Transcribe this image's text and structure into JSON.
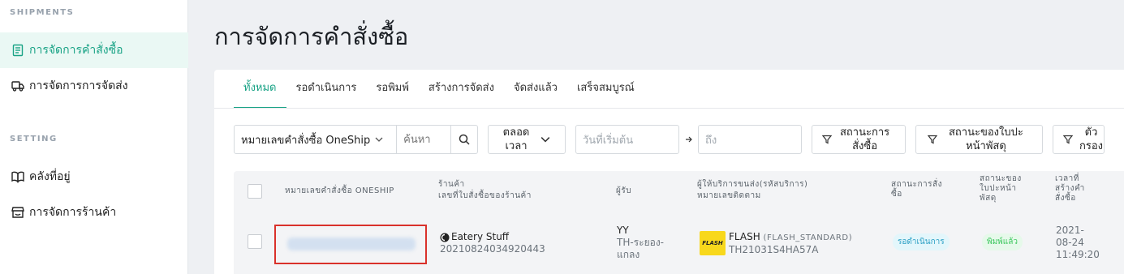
{
  "sidebar": {
    "section_shipments": "SHIPMENTS",
    "section_setting": "SETTING",
    "items": [
      {
        "label": "การจัดการคำสั่งซื้อ",
        "icon": "document-icon",
        "active": true
      },
      {
        "label": "การจัดการการจัดส่ง",
        "icon": "truck-icon",
        "active": false
      },
      {
        "label": "คลังที่อยู่",
        "icon": "book-icon",
        "active": false
      },
      {
        "label": "การจัดการร้านค้า",
        "icon": "store-icon",
        "active": false
      }
    ]
  },
  "page_title": "การจัดการคำสั่งซื้อ",
  "tabs": [
    {
      "label": "ทั้งหมด",
      "active": true
    },
    {
      "label": "รอดำเนินการ"
    },
    {
      "label": "รอพิมพ์"
    },
    {
      "label": "สร้างการจัดส่ง"
    },
    {
      "label": "จัดส่งแล้ว"
    },
    {
      "label": "เสร็จสมบูรณ์"
    }
  ],
  "filters": {
    "search_type": "หมายเลขคำสั่งซื้อ OneShip",
    "search_placeholder": "ค้นหา",
    "period_line1": "ตลอด",
    "period_line2": "เวลา",
    "start_date_placeholder": "วันที่เริ่มต้น",
    "end_date_placeholder": "ถึง",
    "order_status_line1": "สถานะการ",
    "order_status_line2": "สั่งซื้อ",
    "label_status_line1": "สถานะของใบปะ",
    "label_status_line2": "หน้าพัสดุ",
    "filter_line1": "ตัว",
    "filter_line2": "กรอง"
  },
  "table": {
    "headers": {
      "oneship_no": "หมายเลขคำสั่งซื้อ ONESHIP",
      "store": "ร้านค้า",
      "store_sub": "เลขที่ใบสั่งซื้อของร้านค้า",
      "recipient": "ผู้รับ",
      "carrier": "ผู้ให้บริการขนส่ง",
      "carrier_code": "(รหัสบริการ)",
      "tracking": "หมายเลขติดตาม",
      "order_status_1": "สถานะการสั่ง",
      "order_status_2": "ซื้อ",
      "label_status_1": "สถานะของ",
      "label_status_2": "ใบปะหน้า",
      "label_status_3": "พัสดุ",
      "created_1": "เวลาที่",
      "created_2": "สร้างคำ",
      "created_3": "สั่งซื้อ"
    },
    "rows": [
      {
        "store_name": "Eatery Stuff",
        "store_order": "20210824034920443",
        "recipient_name": "YY",
        "recipient_addr_1": "TH-ระยอง-",
        "recipient_addr_2": "แกลง",
        "carrier_name": "FLASH",
        "carrier_service": "(FLASH_STANDARD)",
        "tracking_no": "TH21031S4HA57A",
        "carrier_logo_text": "FLASH",
        "order_status": "รอดำเนินการ",
        "label_status": "พิมพ์แล้ว",
        "created_date_1": "2021-",
        "created_date_2": "08-24",
        "created_time": "11:49:20"
      }
    ]
  },
  "colors": {
    "accent": "#1aa386",
    "highlight_border": "#d9312b",
    "status_pending_bg": "#e3f6fb",
    "status_pending_fg": "#2a9fc4",
    "status_printed_bg": "#e6f9ea",
    "status_printed_fg": "#38c65a",
    "flash_yellow": "#f8d81c"
  }
}
